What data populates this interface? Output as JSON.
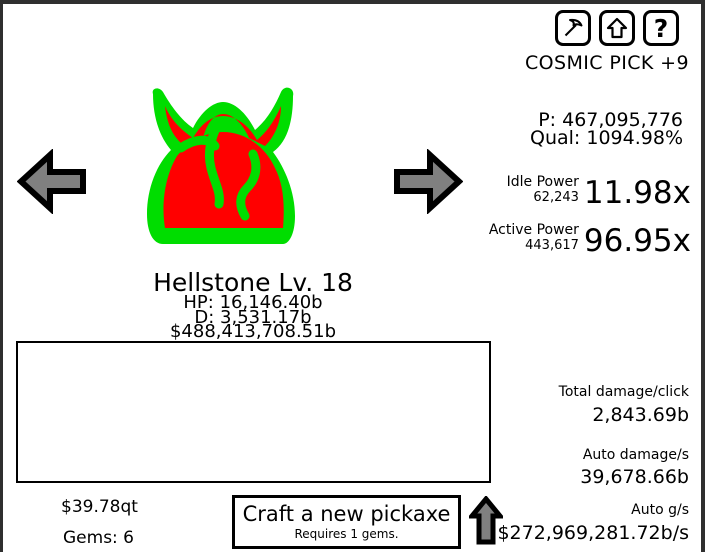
{
  "window": {
    "background_color": "#ffffff",
    "border_color": "#2f2f2f",
    "text_color": "#000000"
  },
  "toolbar": {
    "icons": [
      {
        "name": "pickaxe-icon",
        "label": "Pickaxe"
      },
      {
        "name": "upgrade-arrow-icon",
        "label": "Upgrade"
      },
      {
        "name": "help-icon",
        "label": "?"
      }
    ],
    "help_glyph": "?"
  },
  "pickaxe": {
    "name": "COSMIC PICK +9",
    "power": "P: 467,095,776",
    "quality": "Qual: 1094.98%"
  },
  "power": {
    "idle": {
      "title": "Idle Power",
      "amount": "62,243",
      "multiplier": "11.98x"
    },
    "active": {
      "title": "Active Power",
      "amount": "443,617",
      "multiplier": "96.95x"
    }
  },
  "stats": [
    {
      "label": "Total damage/click",
      "value": "2,843.69b"
    },
    {
      "label": "Auto damage/s",
      "value": "39,678.66b"
    },
    {
      "label": "Auto g/s",
      "value": "$272,969,281.72b/s"
    }
  ],
  "monster": {
    "name": "Hellstone Lv. 18",
    "hp": "HP: 16,146.40b",
    "damage": "D: 3,531.17b",
    "gold": "$488,413,708.51b",
    "sprite_name": "hellstone-demon-head",
    "body_color": "#ff0000",
    "outline_color": "#00dd00"
  },
  "navigation": {
    "prev_name": "previous-monster-arrow",
    "next_name": "next-monster-arrow",
    "arrow_fill": "#808080",
    "arrow_outline": "#000000"
  },
  "log": {
    "entries": []
  },
  "currency": {
    "money": "$39.78qt",
    "gems": "Gems: 6"
  },
  "craft": {
    "title": "Craft a new pickaxe",
    "requirement": "Requires 1 gems.",
    "upgrade_arrow_name": "craft-upgrade-arrow"
  }
}
